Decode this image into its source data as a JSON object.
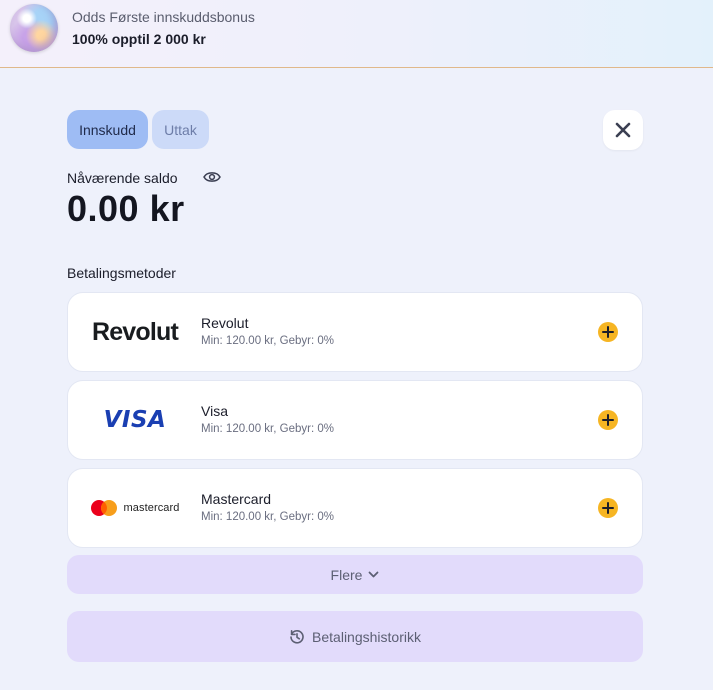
{
  "banner": {
    "title": "Odds Første innskuddsbonus",
    "subtitle": "100% opptil 2 000 kr"
  },
  "tabs": [
    {
      "label": "Innskudd",
      "active": true
    },
    {
      "label": "Uttak",
      "active": false
    }
  ],
  "balance": {
    "label": "Nåværende saldo",
    "value": "0.00 kr"
  },
  "payment_methods": {
    "heading": "Betalingsmetoder",
    "items": [
      {
        "logo_text": "Revolut",
        "name": "Revolut",
        "info": "Min: 120.00 kr, Gebyr: 0%"
      },
      {
        "logo_text": "VISA",
        "name": "Visa",
        "info": "Min: 120.00 kr, Gebyr: 0%"
      },
      {
        "logo_text": "mastercard",
        "name": "Mastercard",
        "info": "Min: 120.00 kr, Gebyr: 0%"
      }
    ]
  },
  "more_label": "Flere",
  "history_label": "Betalingshistorikk",
  "colors": {
    "accent_plus": "#f6b523",
    "tab_active": "#9ebcf4",
    "button_bg": "#e2dbfb",
    "visa_blue": "#1a3fb2"
  }
}
